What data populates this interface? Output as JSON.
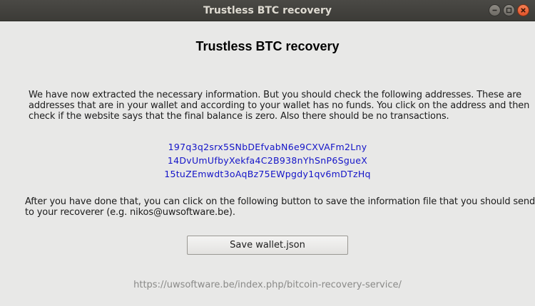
{
  "window": {
    "title": "Trustless BTC recovery",
    "controls": {
      "minimize_icon": "minimize-icon",
      "maximize_icon": "maximize-icon",
      "close_icon": "close-icon"
    }
  },
  "main": {
    "heading": "Trustless BTC recovery",
    "instructions": [
      "We have now extracted the necessary information. But you should check the following addresses. These are",
      "addresses that are in your wallet and according to your wallet has no funds. You click on the address and then",
      "check if the website says that the final balance is zero. Also there should be no transactions."
    ],
    "addresses": [
      "197q3q2srx5SNbDEfvabN6e9CXVAFm2Lny",
      "14DvUmUfbyXekfa4C2B938nYhSnP6SgueX",
      "15tuZEmwdt3oAqBz75EWpgdy1qv6mDTzHq"
    ],
    "after_text": [
      "After you have done that, you can click on the following button to save the information file that you should send",
      "to your recoverer (e.g. nikos@uwsoftware.be)."
    ],
    "save_button_label": "Save wallet.json",
    "footer_link": "https://uwsoftware.be/index.php/bitcoin-recovery-service/"
  },
  "colors": {
    "background": "#e8e8e7",
    "titlebar": "#3c3b37",
    "link": "#1414c8",
    "footer": "#8a8a88",
    "close_button": "#e3532a"
  }
}
